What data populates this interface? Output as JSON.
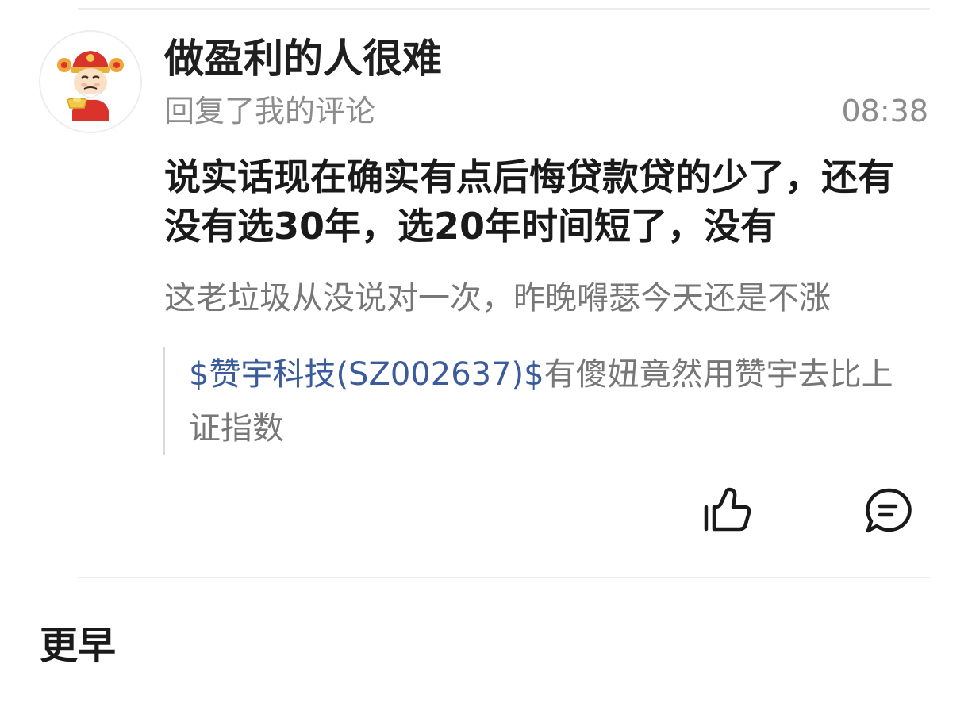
{
  "notification": {
    "username": "做盈利的人很难",
    "action_text": "回复了我的评论",
    "time": "08:38",
    "reply_text": "说实话现在确实有点后悔贷款贷的少了，还有没有选30年，选20年时间短了，没有",
    "my_comment": "这老垃圾从没说对一次，昨晚嘚瑟今天还是不涨",
    "quoted_post": {
      "stock_link": "$赞宇科技(SZ002637)$",
      "text": "有傻妞竟然用赞宇去比上证指数"
    },
    "icons": {
      "avatar": "god-of-wealth-avatar",
      "like": "thumbs-up-icon",
      "comment": "comment-bubble-icon"
    }
  },
  "section": {
    "title": "更早"
  },
  "colors": {
    "link": "#3b5b9a",
    "secondary_text": "#8c8c8c",
    "divider": "#ececec"
  }
}
